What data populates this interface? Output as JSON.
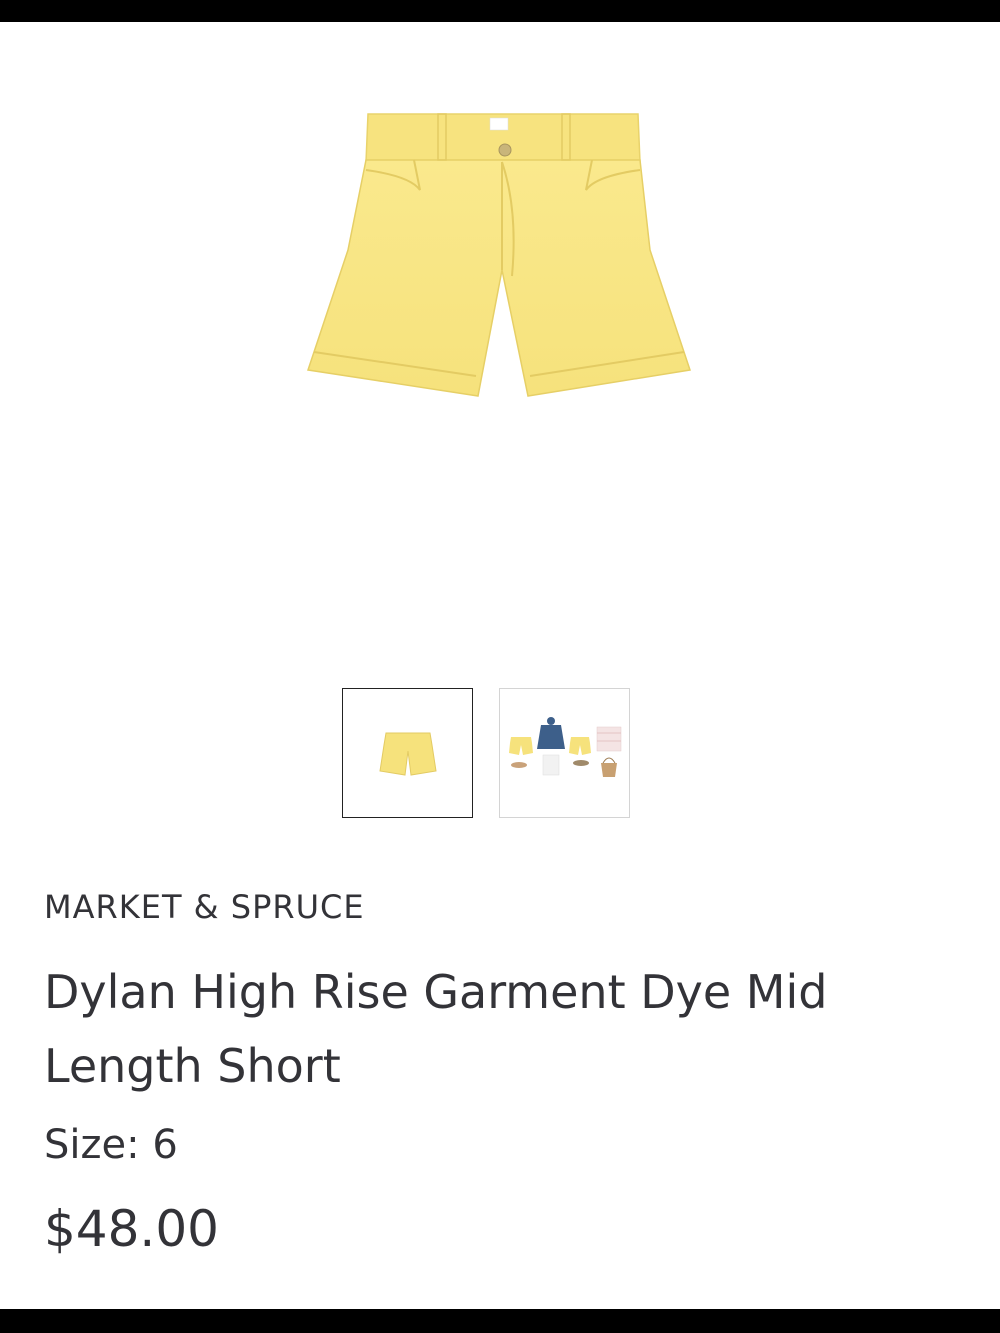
{
  "product": {
    "brand": "MARKET & SPRUCE",
    "name": "Dylan High Rise Garment Dye Mid Length Short",
    "size_label": "Size:",
    "size_value": "6",
    "price": "$48.00",
    "color": "#f8e68a"
  },
  "gallery": {
    "selected_index": 0,
    "thumbnails": [
      {
        "name": "product-image-thumb"
      },
      {
        "name": "outfit-image-thumb"
      }
    ]
  }
}
